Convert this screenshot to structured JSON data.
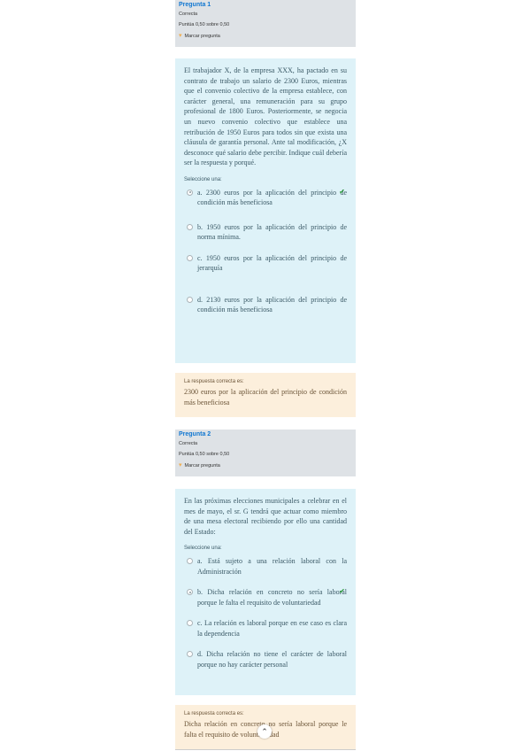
{
  "q1": {
    "number_label": "Pregunta 1",
    "status": "Correcta",
    "score": "Puntúa 0,50 sobre 0,50",
    "flag_label": "Marcar pregunta",
    "text": "El trabajador X, de la empresa XXX, ha pactado en su contrato de trabajo un salario de 2300 Euros, mientras que el convenio colectivo de la empresa establece, con carácter general, una remuneración para su grupo profesional de 1800 Euros. Posteriormente, se negocia un nuevo convenio colectivo que establece una retribución de 1950 Euros para todos sin que exista una cláusula de garantía personal. Ante tal modificación, ¿X desconoce qué salario debe percibir. Indique cuál debería ser la respuesta y porqué.",
    "prompt": "Seleccione una:",
    "answers": [
      {
        "letter": "a.",
        "text": "2300 euros por la aplicación del principio de condición más beneficiosa",
        "selected": true,
        "correct": true
      },
      {
        "letter": "b.",
        "text": "1950 euros por la aplicación del principio de norma mínima.",
        "selected": false,
        "correct": false
      },
      {
        "letter": "c.",
        "text": "1950 euros por la aplicación del principio de jerarquía",
        "selected": false,
        "correct": false
      },
      {
        "letter": "d.",
        "text": "2130 euros por la aplicación del principio de condición más beneficiosa",
        "selected": false,
        "correct": false
      }
    ],
    "feedback_label": "La respuesta correcta es:",
    "feedback_text": "2300 euros por la aplicación del principio de condición más beneficiosa"
  },
  "q2": {
    "number_label": "Pregunta 2",
    "status": "Correcta",
    "score": "Puntúa 0,50 sobre 0,50",
    "flag_label": "Marcar pregunta",
    "text": "En las próximas elecciones municipales a celebrar en el mes de mayo, el sr. G tendrá que actuar como miembro de una mesa electoral recibiendo por ello una cantidad del Estado:",
    "prompt": "Seleccione una:",
    "answers": [
      {
        "letter": "a.",
        "text": "Está sujeto a una relación laboral con la Administración",
        "selected": false,
        "correct": false
      },
      {
        "letter": "b.",
        "text": "Dicha relación en concreto no sería laboral porque le falta el requisito de voluntariedad",
        "selected": true,
        "correct": true
      },
      {
        "letter": "c.",
        "text": "La relación es laboral porque en ese caso es clara la dependencia",
        "selected": false,
        "correct": false
      },
      {
        "letter": "d.",
        "text": "Dicha relación no tiene el carácter de laboral porque no hay carácter personal",
        "selected": false,
        "correct": false
      }
    ],
    "feedback_label": "La respuesta correcta es:",
    "feedback_text": "Dicha relación en concreto no sería laboral porque le falta el requisito de voluntariedad"
  },
  "icons": {
    "flag": "flag-icon",
    "check": "check-icon",
    "scroll_top": "chevron-up-icon"
  },
  "colors": {
    "info_bg": "#dee2e6",
    "question_bg": "#def2f8",
    "feedback_bg": "#fcefdc",
    "link": "#1177d1",
    "correct": "#2e9e3e"
  }
}
